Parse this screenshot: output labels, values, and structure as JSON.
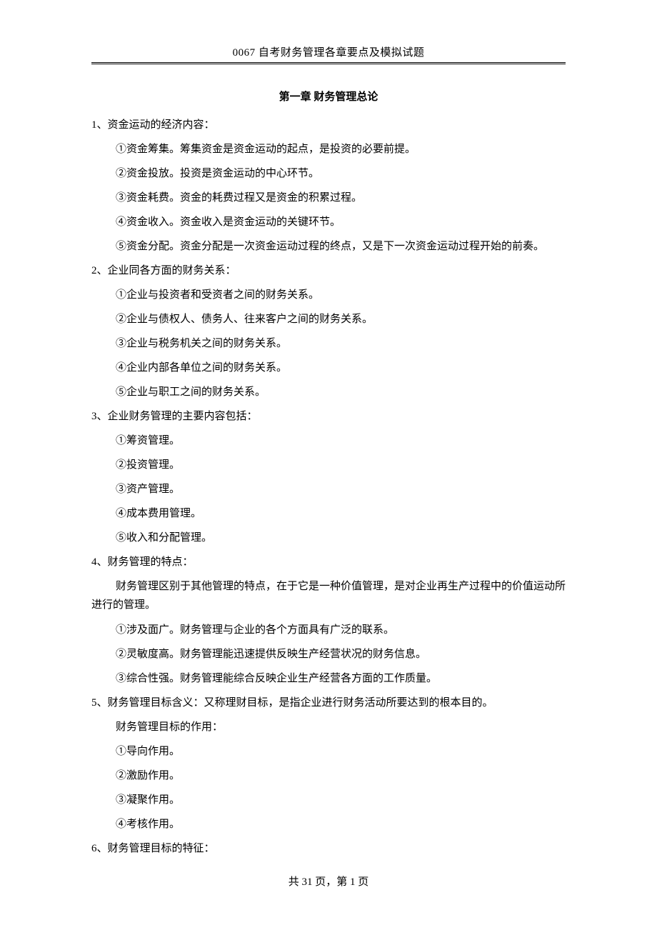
{
  "header": "0067 自考财务管理各章要点及模拟试题",
  "chapter_title": "第一章  财务管理总论",
  "sections": {
    "s1": {
      "title": "1、资金运动的经济内容：",
      "items": [
        "①资金筹集。筹集资金是资金运动的起点，是投资的必要前提。",
        "②资金投放。投资是资金运动的中心环节。",
        "③资金耗费。资金的耗费过程又是资金的积累过程。",
        "④资金收入。资金收入是资金运动的关键环节。",
        "⑤资金分配。资金分配是一次资金运动过程的终点，又是下一次资金运动过程开始的前奏。"
      ]
    },
    "s2": {
      "title": "2、企业同各方面的财务关系：",
      "items": [
        "①企业与投资者和受资者之间的财务关系。",
        "②企业与债权人、债务人、往来客户之间的财务关系。",
        "③企业与税务机关之间的财务关系。",
        "④企业内部各单位之间的财务关系。",
        "⑤企业与职工之间的财务关系。"
      ]
    },
    "s3": {
      "title": "3、企业财务管理的主要内容包括：",
      "items": [
        "①筹资管理。",
        "②投资管理。",
        "③资产管理。",
        "④成本费用管理。",
        "⑤收入和分配管理。"
      ]
    },
    "s4": {
      "title": "4、财务管理的特点：",
      "intro": "财务管理区别于其他管理的特点，在于它是一种价值管理，是对企业再生产过程中的价值运动所进行的管理。",
      "items": [
        "①涉及面广。财务管理与企业的各个方面具有广泛的联系。",
        "②灵敏度高。财务管理能迅速提供反映生产经营状况的财务信息。",
        "③综合性强。财务管理能综合反映企业生产经营各方面的工作质量。"
      ]
    },
    "s5": {
      "title": "5、财务管理目标含义：又称理财目标，是指企业进行财务活动所要达到的根本目的。",
      "sub": "财务管理目标的作用：",
      "items": [
        "①导向作用。",
        "②激励作用。",
        "③凝聚作用。",
        "④考核作用。"
      ]
    },
    "s6": {
      "title": "6、财务管理目标的特征："
    }
  },
  "footer": "共 31 页，第 1 页"
}
